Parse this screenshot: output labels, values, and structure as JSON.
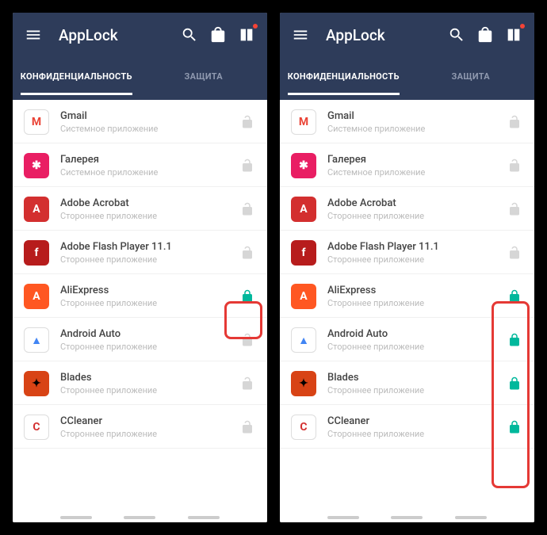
{
  "header": {
    "title": "AppLock",
    "tabs": [
      "КОНФИДЕНЦИАЛЬНОСТЬ",
      "ЗАЩИТА"
    ]
  },
  "subtitles": {
    "system": "Системное приложение",
    "third": "Стороннее приложение"
  },
  "apps": [
    {
      "name": "Gmail",
      "type": "system",
      "bg": "#fff",
      "fg": "#ea4335",
      "glyph": "M"
    },
    {
      "name": "Галерея",
      "type": "system",
      "bg": "#e91e63",
      "fg": "#fff",
      "glyph": "✱"
    },
    {
      "name": "Adobe Acrobat",
      "type": "third",
      "bg": "#d32f2f",
      "fg": "#fff",
      "glyph": "A"
    },
    {
      "name": "Adobe Flash Player 11.1",
      "type": "third",
      "bg": "#b71c1c",
      "fg": "#fff",
      "glyph": "f"
    },
    {
      "name": "AliExpress",
      "type": "third",
      "bg": "#ff5722",
      "fg": "#fff",
      "glyph": "A"
    },
    {
      "name": "Android Auto",
      "type": "third",
      "bg": "#fff",
      "fg": "#4285f4",
      "glyph": "▲"
    },
    {
      "name": "Blades",
      "type": "third",
      "bg": "#d84315",
      "fg": "#000",
      "glyph": "✦"
    },
    {
      "name": "CCleaner",
      "type": "third",
      "bg": "#fff",
      "fg": "#d32f2f",
      "glyph": "C"
    }
  ],
  "left_locked": [
    4
  ],
  "right_locked": [
    4,
    5,
    6,
    7
  ]
}
